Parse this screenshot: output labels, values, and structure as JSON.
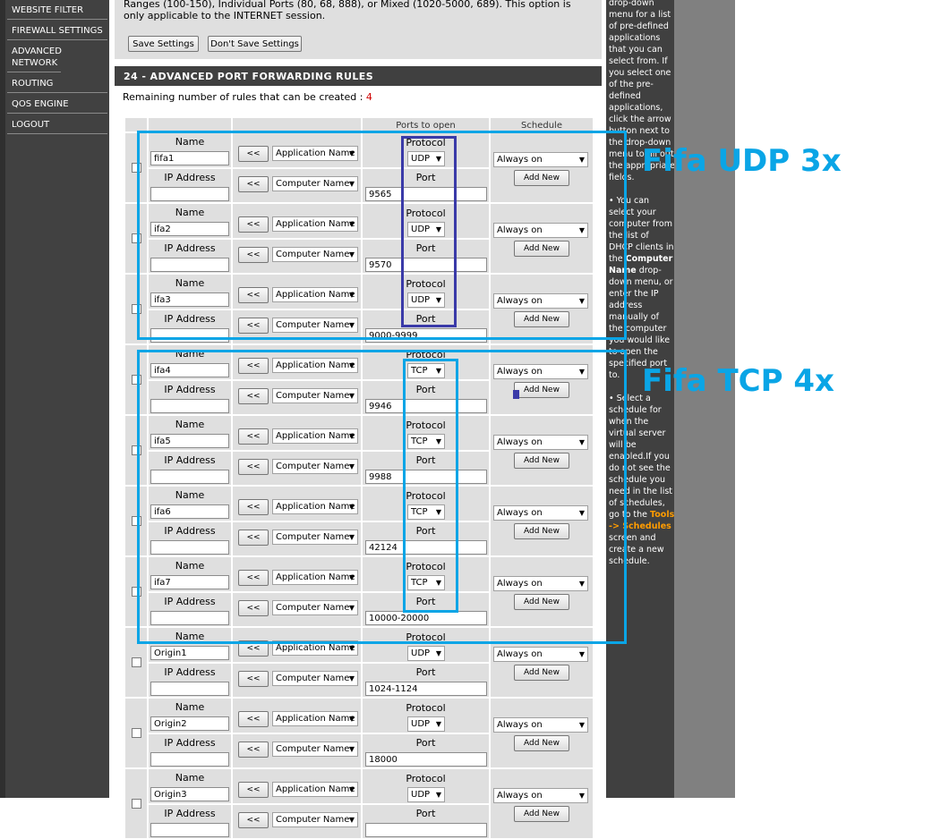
{
  "nav": {
    "items": [
      "WEBSITE FILTER",
      "FIREWALL SETTINGS",
      "ADVANCED NETWORK",
      "ROUTING",
      "QOS ENGINE",
      "LOGOUT"
    ]
  },
  "top": {
    "text": "Ranges (100-150), Individual Ports (80, 68, 888), or Mixed (1020-5000, 689). This option is only applicable to the INTERNET session.",
    "save_label": "Save Settings",
    "dont_save_label": "Don't Save Settings"
  },
  "section": {
    "title": "24 - ADVANCED PORT FORWARDING RULES",
    "remaining_label": "Remaining number of rules that can be created :",
    "remaining_count": "4"
  },
  "table": {
    "col_ports": "Ports to open",
    "col_schedule": "Schedule",
    "name_label": "Name",
    "ip_label": "IP Address",
    "protocol_label": "Protocol",
    "port_label": "Port",
    "arrow_label": "<<",
    "app_select": "Application Name",
    "computer_select": "Computer Name",
    "schedule_value": "Always on",
    "add_new_label": "Add New",
    "rows": [
      {
        "name": "fifa1",
        "protocol": "UDP",
        "port": "9565"
      },
      {
        "name": "ifa2",
        "protocol": "UDP",
        "port": "9570"
      },
      {
        "name": "ifa3",
        "protocol": "UDP",
        "port": "9000-9999"
      },
      {
        "name": "ifa4",
        "protocol": "TCP",
        "port": "9946"
      },
      {
        "name": "ifa5",
        "protocol": "TCP",
        "port": "9988"
      },
      {
        "name": "ifa6",
        "protocol": "TCP",
        "port": "42124"
      },
      {
        "name": "ifa7",
        "protocol": "TCP",
        "port": "10000-20000"
      },
      {
        "name": "Origin1",
        "protocol": "UDP",
        "port": "1024-1124"
      },
      {
        "name": "Origin2",
        "protocol": "UDP",
        "port": "18000"
      },
      {
        "name": "Origin3",
        "protocol": "UDP",
        "port": ""
      }
    ]
  },
  "help": {
    "p1": "drop-down menu for a list of pre-defined applications that you can select from. If you select one of the pre-defined applications, click the arrow button next to the drop-down menu to fill out the appropriate fields.",
    "p2a": "• You can select your computer from the list of DHCP clients in the",
    "p2b": "Computer Name",
    "p2c": "drop-down menu, or enter the IP address manually of the computer you would like to open the specified port to.",
    "p3a": "• Select a schedule for when the virtual server will be enabled.If you do not see the schedule you need in the list of schedules, go to the",
    "p3b": "Tools -> Schedules",
    "p3c": "screen and create a new schedule."
  },
  "annotations": {
    "udp_label": "Fifa UDP 3x",
    "tcp_label": "Fifa TCP 4x",
    "udp_color": "#0aa5e6",
    "tcp_color": "#0aa5e6",
    "protocol_box_color": "#3a3aa8"
  }
}
